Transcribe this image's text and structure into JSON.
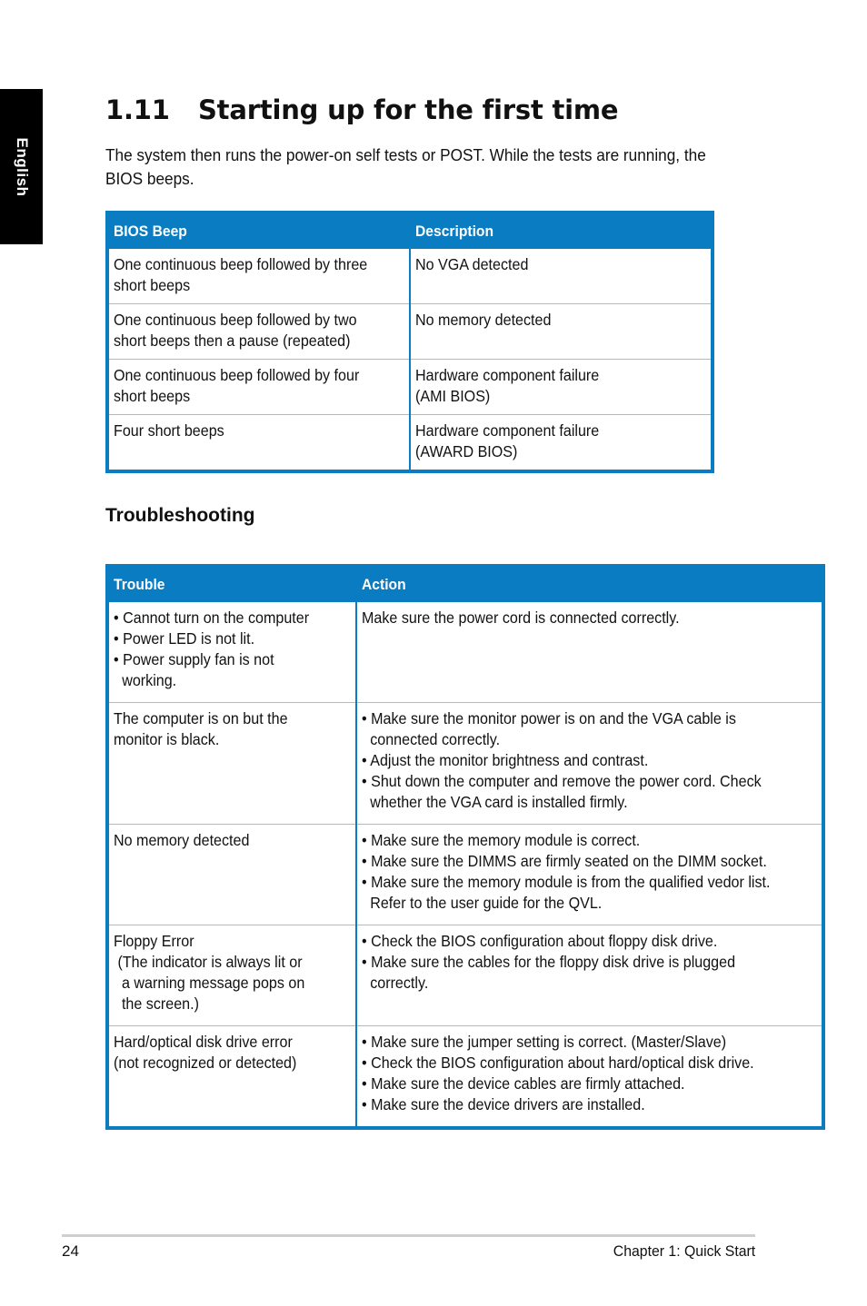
{
  "side_tab": {
    "label": "English"
  },
  "heading": {
    "number": "1.11",
    "title": "Starting up for the first time"
  },
  "intro": "The system then runs the power-on self tests or POST. While the tests are running, the BIOS beeps.",
  "colors": {
    "accent": "#0a7cc1",
    "row_divider": "#b8b8b8",
    "side_tab": "#000000"
  },
  "bios_table": {
    "headers": [
      "BIOS Beep",
      "Description"
    ],
    "rows": [
      {
        "beep": [
          "One continuous beep followed by three",
          "short beeps"
        ],
        "description": [
          "No VGA detected"
        ]
      },
      {
        "beep": [
          "One continuous beep followed by two",
          "short beeps then a pause (repeated)"
        ],
        "description": [
          "No memory detected"
        ]
      },
      {
        "beep": [
          "One continuous beep followed by four",
          "short beeps"
        ],
        "description": [
          "Hardware component failure",
          "(AMI BIOS)"
        ]
      },
      {
        "beep": [
          "Four short beeps"
        ],
        "description": [
          "Hardware component failure",
          "(AWARD BIOS)"
        ]
      }
    ]
  },
  "troubleshooting": {
    "heading": "Troubleshooting",
    "headers": [
      "Trouble",
      "Action"
    ],
    "rows": [
      {
        "trouble": [
          "• Cannot turn on the computer",
          "• Power LED is not lit.",
          "• Power supply fan is not working."
        ],
        "action": [
          "Make sure the power cord is connected correctly."
        ]
      },
      {
        "trouble": [
          "The computer is on but the",
          "monitor is black."
        ],
        "action": [
          "• Make sure the monitor power is on and the VGA cable is connected correctly.",
          "• Adjust the monitor brightness and contrast.",
          "• Shut down the computer and remove the power cord. Check whether the VGA card is installed firmly."
        ]
      },
      {
        "trouble": [
          "No memory detected"
        ],
        "action": [
          "• Make sure the memory module is correct.",
          "• Make sure the DIMMS are firmly seated on the DIMM socket.",
          "• Make sure the memory module is from the qualified vedor list. Refer to the user guide for the QVL."
        ]
      },
      {
        "trouble": [
          "Floppy Error",
          " (The indicator is always lit or",
          "  a warning message pops on",
          "  the screen.)"
        ],
        "action": [
          "• Check the BIOS configuration about floppy disk drive.",
          "• Make sure the cables for the floppy disk drive is plugged correctly."
        ]
      },
      {
        "trouble": [
          "Hard/optical disk drive error",
          "(not recognized or detected)"
        ],
        "action": [
          "• Make sure the jumper setting is correct. (Master/Slave)",
          "• Check the BIOS configuration about hard/optical disk drive.",
          "• Make sure the device cables are firmly  attached.",
          "• Make sure the device drivers are installed."
        ]
      }
    ]
  },
  "footer": {
    "page_number": "24",
    "chapter": "Chapter 1: Quick Start"
  }
}
